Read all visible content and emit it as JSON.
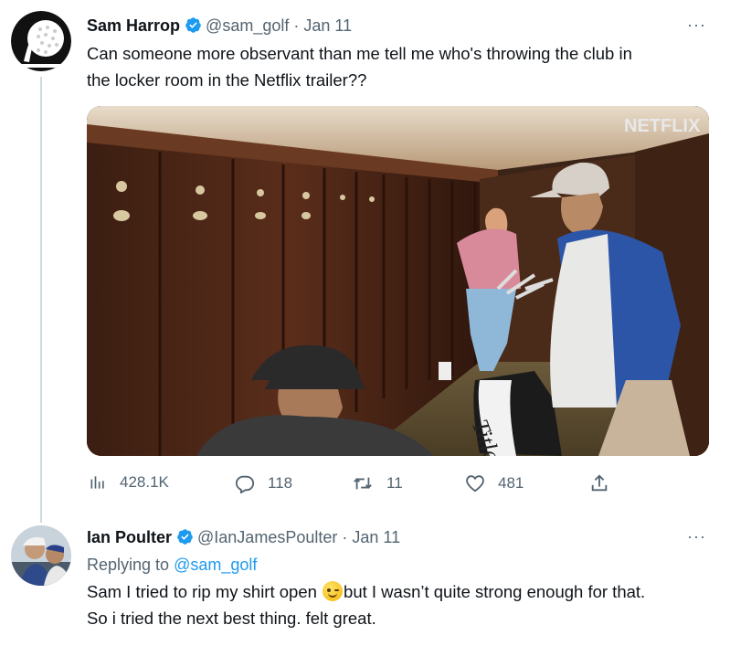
{
  "tweet1": {
    "name": "Sam Harrop",
    "handle": "@sam_golf",
    "separator": "·",
    "date": "Jan 11",
    "more": "···",
    "text_line1": "Can someone more observant than me tell me who's throwing the club in",
    "text_line2": "the locker room in the Netflix trailer??",
    "media_watermark": "NETFLIX",
    "stats": {
      "views": "428.1K",
      "replies": "118",
      "retweets": "11",
      "likes": "481"
    }
  },
  "tweet2": {
    "name": "Ian Poulter",
    "handle": "@IanJamesPoulter",
    "separator": "·",
    "date": "Jan 11",
    "more": "···",
    "replying_prefix": "Replying to",
    "replying_to": "@sam_golf",
    "text_part1": "Sam I tried to rip my shirt open",
    "text_part2": "but I wasn’t quite strong enough for that.",
    "text_line2": "So i tried the next best thing. felt great."
  },
  "colors": {
    "text": "#0f1419",
    "muted": "#536471",
    "link": "#1d9bf0",
    "verified": "#1d9bf0",
    "thread_line": "#cfd9de"
  }
}
